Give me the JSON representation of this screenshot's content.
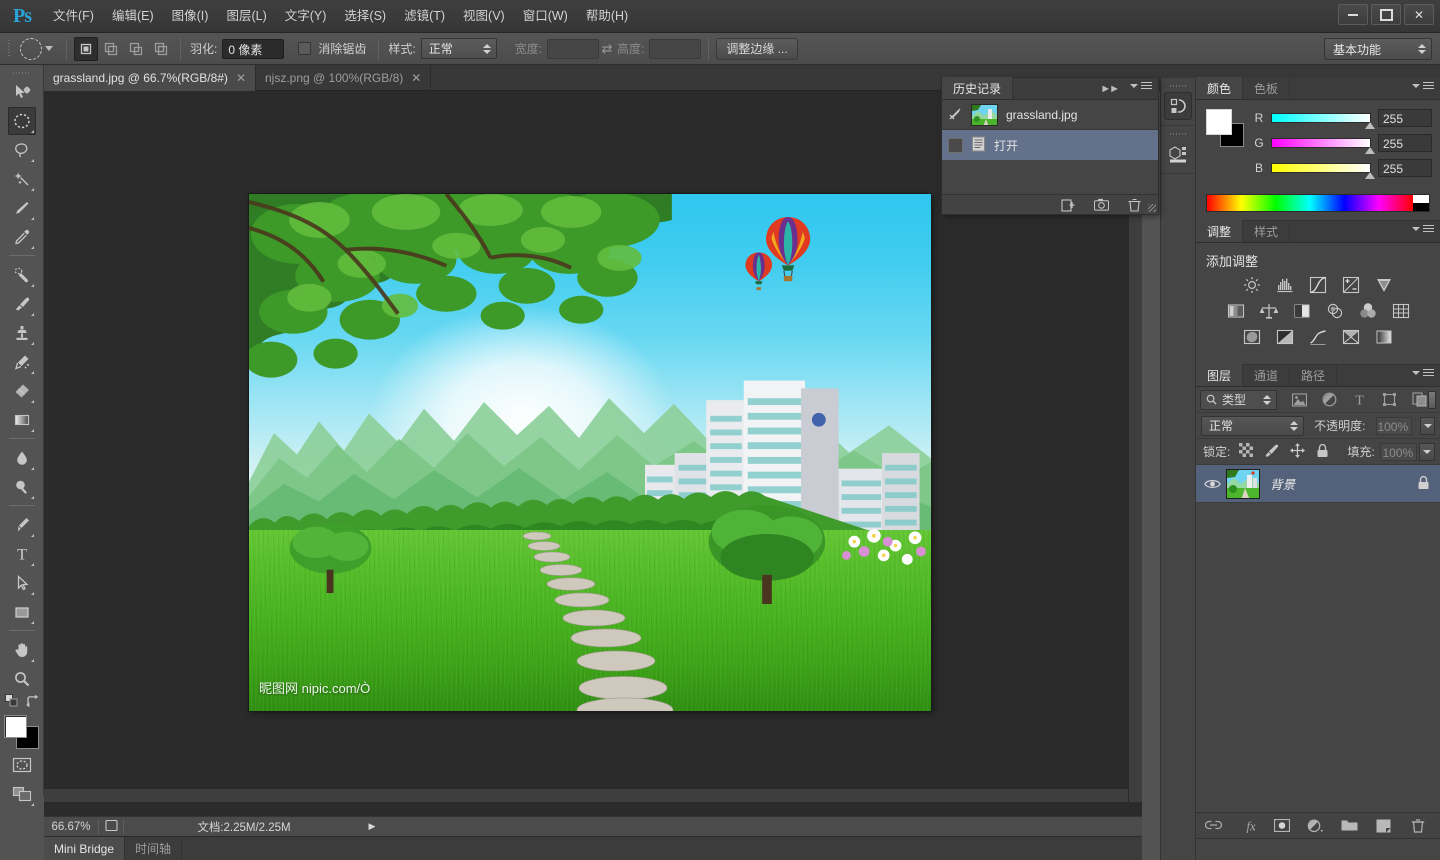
{
  "app": {
    "name": "Ps",
    "logo_color": "#2aa3d8"
  },
  "titlebar": {
    "menus": [
      {
        "label": "文件(F)",
        "name": "menu-file"
      },
      {
        "label": "编辑(E)",
        "name": "menu-edit"
      },
      {
        "label": "图像(I)",
        "name": "menu-image"
      },
      {
        "label": "图层(L)",
        "name": "menu-layer"
      },
      {
        "label": "文字(Y)",
        "name": "menu-type"
      },
      {
        "label": "选择(S)",
        "name": "menu-select"
      },
      {
        "label": "滤镜(T)",
        "name": "menu-filter"
      },
      {
        "label": "视图(V)",
        "name": "menu-view"
      },
      {
        "label": "窗口(W)",
        "name": "menu-window"
      },
      {
        "label": "帮助(H)",
        "name": "menu-help"
      }
    ],
    "window_controls": [
      "minimize",
      "maximize",
      "close"
    ]
  },
  "options_bar": {
    "tool_preset_icon": "elliptical-marquee-icon",
    "selection_modes": [
      "new-selection",
      "add-to-selection",
      "subtract-from-selection",
      "intersect-selection"
    ],
    "active_selection_mode": 0,
    "feather_label": "羽化:",
    "feather_value": "0 像素",
    "antialias_label": "消除锯齿",
    "antialias_checked": false,
    "style_label": "样式:",
    "style_value": "正常",
    "width_label": "宽度:",
    "width_value": "",
    "height_label": "高度:",
    "height_value": "",
    "refine_edge_label": "调整边缘 ...",
    "workspace_value": "基本功能"
  },
  "tabs": [
    {
      "label": "grassland.jpg @ 66.7%(RGB/8#)",
      "active": true
    },
    {
      "label": "njsz.png @ 100%(RGB/8)",
      "active": false
    }
  ],
  "toolbar": {
    "tools": [
      {
        "name": "move-tool",
        "icon": "move-icon",
        "active": false,
        "has_flyout": false
      },
      {
        "name": "elliptical-marquee-tool",
        "icon": "ellipse-marquee-icon",
        "active": true,
        "has_flyout": true
      },
      {
        "name": "lasso-tool",
        "icon": "lasso-icon",
        "active": false,
        "has_flyout": true
      },
      {
        "name": "magic-wand-tool",
        "icon": "magic-wand-icon",
        "active": false,
        "has_flyout": true
      },
      {
        "name": "crop-tool",
        "icon": "crop-icon",
        "active": false,
        "has_flyout": true
      },
      {
        "name": "eyedropper-tool",
        "icon": "eyedropper-icon",
        "active": false,
        "has_flyout": true
      },
      {
        "name": "spot-healing-tool",
        "icon": "healing-brush-icon",
        "active": false,
        "has_flyout": true
      },
      {
        "name": "brush-tool",
        "icon": "brush-icon",
        "active": false,
        "has_flyout": true
      },
      {
        "name": "clone-stamp-tool",
        "icon": "clone-stamp-icon",
        "active": false,
        "has_flyout": true
      },
      {
        "name": "history-brush-tool",
        "icon": "history-brush-icon",
        "active": false,
        "has_flyout": true
      },
      {
        "name": "eraser-tool",
        "icon": "eraser-icon",
        "active": false,
        "has_flyout": true
      },
      {
        "name": "gradient-tool",
        "icon": "gradient-icon",
        "active": false,
        "has_flyout": true
      },
      {
        "name": "blur-tool",
        "icon": "blur-drop-icon",
        "active": false,
        "has_flyout": true
      },
      {
        "name": "dodge-tool",
        "icon": "dodge-icon",
        "active": false,
        "has_flyout": true
      },
      {
        "name": "pen-tool",
        "icon": "pen-icon",
        "active": false,
        "has_flyout": true
      },
      {
        "name": "type-tool",
        "icon": "type-t-icon",
        "active": false,
        "has_flyout": true
      },
      {
        "name": "path-selection-tool",
        "icon": "path-arrow-icon",
        "active": false,
        "has_flyout": true
      },
      {
        "name": "rectangle-shape-tool",
        "icon": "rectangle-icon",
        "active": false,
        "has_flyout": true
      },
      {
        "name": "hand-tool",
        "icon": "hand-icon",
        "active": false,
        "has_flyout": true
      },
      {
        "name": "zoom-tool",
        "icon": "zoom-magnifier-icon",
        "active": false,
        "has_flyout": false
      }
    ],
    "foreground_color": "#ffffff",
    "background_color": "#000000",
    "quick_mask_icon": "quick-mask-icon",
    "screen_mode_icon": "screen-mode-icon",
    "default_colors_icon": "default-colors-icon",
    "swap_colors_icon": "swap-colors-icon"
  },
  "document": {
    "watermark": "昵图网 nipic.com/Ò",
    "scene_description": "grassland with trees, mountains, buildings and hot air balloons"
  },
  "history_panel": {
    "tabs": [
      {
        "label": "历史记录",
        "active": true
      }
    ],
    "snapshot": {
      "label": "grassland.jpg",
      "icon": "history-brush-source-icon"
    },
    "states": [
      {
        "label": "打开",
        "selected": true,
        "icon": "document-state-icon"
      }
    ],
    "footer_icons": [
      "new-document-from-state-icon",
      "new-snapshot-icon",
      "delete-state-icon"
    ]
  },
  "color_panel": {
    "tabs": [
      {
        "label": "颜色",
        "active": true
      },
      {
        "label": "色板",
        "active": false
      }
    ],
    "foreground": "#ffffff",
    "background": "#000000",
    "channels": [
      {
        "label": "R",
        "value": "255"
      },
      {
        "label": "G",
        "value": "255"
      },
      {
        "label": "B",
        "value": "255"
      }
    ]
  },
  "adjustments_panel": {
    "tabs": [
      {
        "label": "调整",
        "active": true
      },
      {
        "label": "样式",
        "active": false
      }
    ],
    "title": "添加调整",
    "rows": [
      [
        "brightness-contrast-icon",
        "levels-icon",
        "curves-icon",
        "exposure-icon",
        "vibrance-icon"
      ],
      [
        "hue-saturation-icon",
        "color-balance-icon",
        "black-white-icon",
        "photo-filter-icon",
        "channel-mixer-icon",
        "color-lookup-icon"
      ],
      [
        "invert-icon",
        "posterize-icon",
        "threshold-icon",
        "gradient-map-icon",
        "selective-color-icon"
      ]
    ]
  },
  "layers_panel": {
    "tabs": [
      {
        "label": "图层",
        "active": true
      },
      {
        "label": "通道",
        "active": false
      },
      {
        "label": "路径",
        "active": false
      }
    ],
    "filter_label": "类型",
    "filter_icons": [
      "pixel-layer-filter-icon",
      "adjustment-layer-filter-icon",
      "type-layer-filter-icon",
      "shape-layer-filter-icon",
      "smart-object-filter-icon"
    ],
    "blend_mode": "正常",
    "opacity_label": "不透明度:",
    "opacity_value": "100%",
    "lock_label": "锁定:",
    "lock_icons": [
      "lock-transparency-icon",
      "lock-image-icon",
      "lock-position-icon",
      "lock-all-icon"
    ],
    "fill_label": "填充:",
    "fill_value": "100%",
    "layers": [
      {
        "name": "背景",
        "visible": true,
        "locked": true,
        "selected": true
      }
    ],
    "footer_icons": [
      "link-layers-icon",
      "layer-style-fx-icon",
      "add-mask-icon",
      "new-adjustment-layer-icon",
      "new-group-icon",
      "new-layer-icon",
      "delete-layer-icon"
    ]
  },
  "icon_dock": {
    "items": [
      {
        "name": "history-dock-icon",
        "active": true
      },
      {
        "name": "mini-bridge-dock-icon",
        "active": false
      }
    ]
  },
  "status_bar": {
    "zoom": "66.67%",
    "doc_icon": "document-profile-icon",
    "doc_info": "文档:2.25M/2.25M",
    "expand_arrow": "▶"
  },
  "bottom_dock": {
    "tabs": [
      {
        "label": "Mini Bridge",
        "active": true
      },
      {
        "label": "时间轴",
        "active": false
      }
    ]
  }
}
